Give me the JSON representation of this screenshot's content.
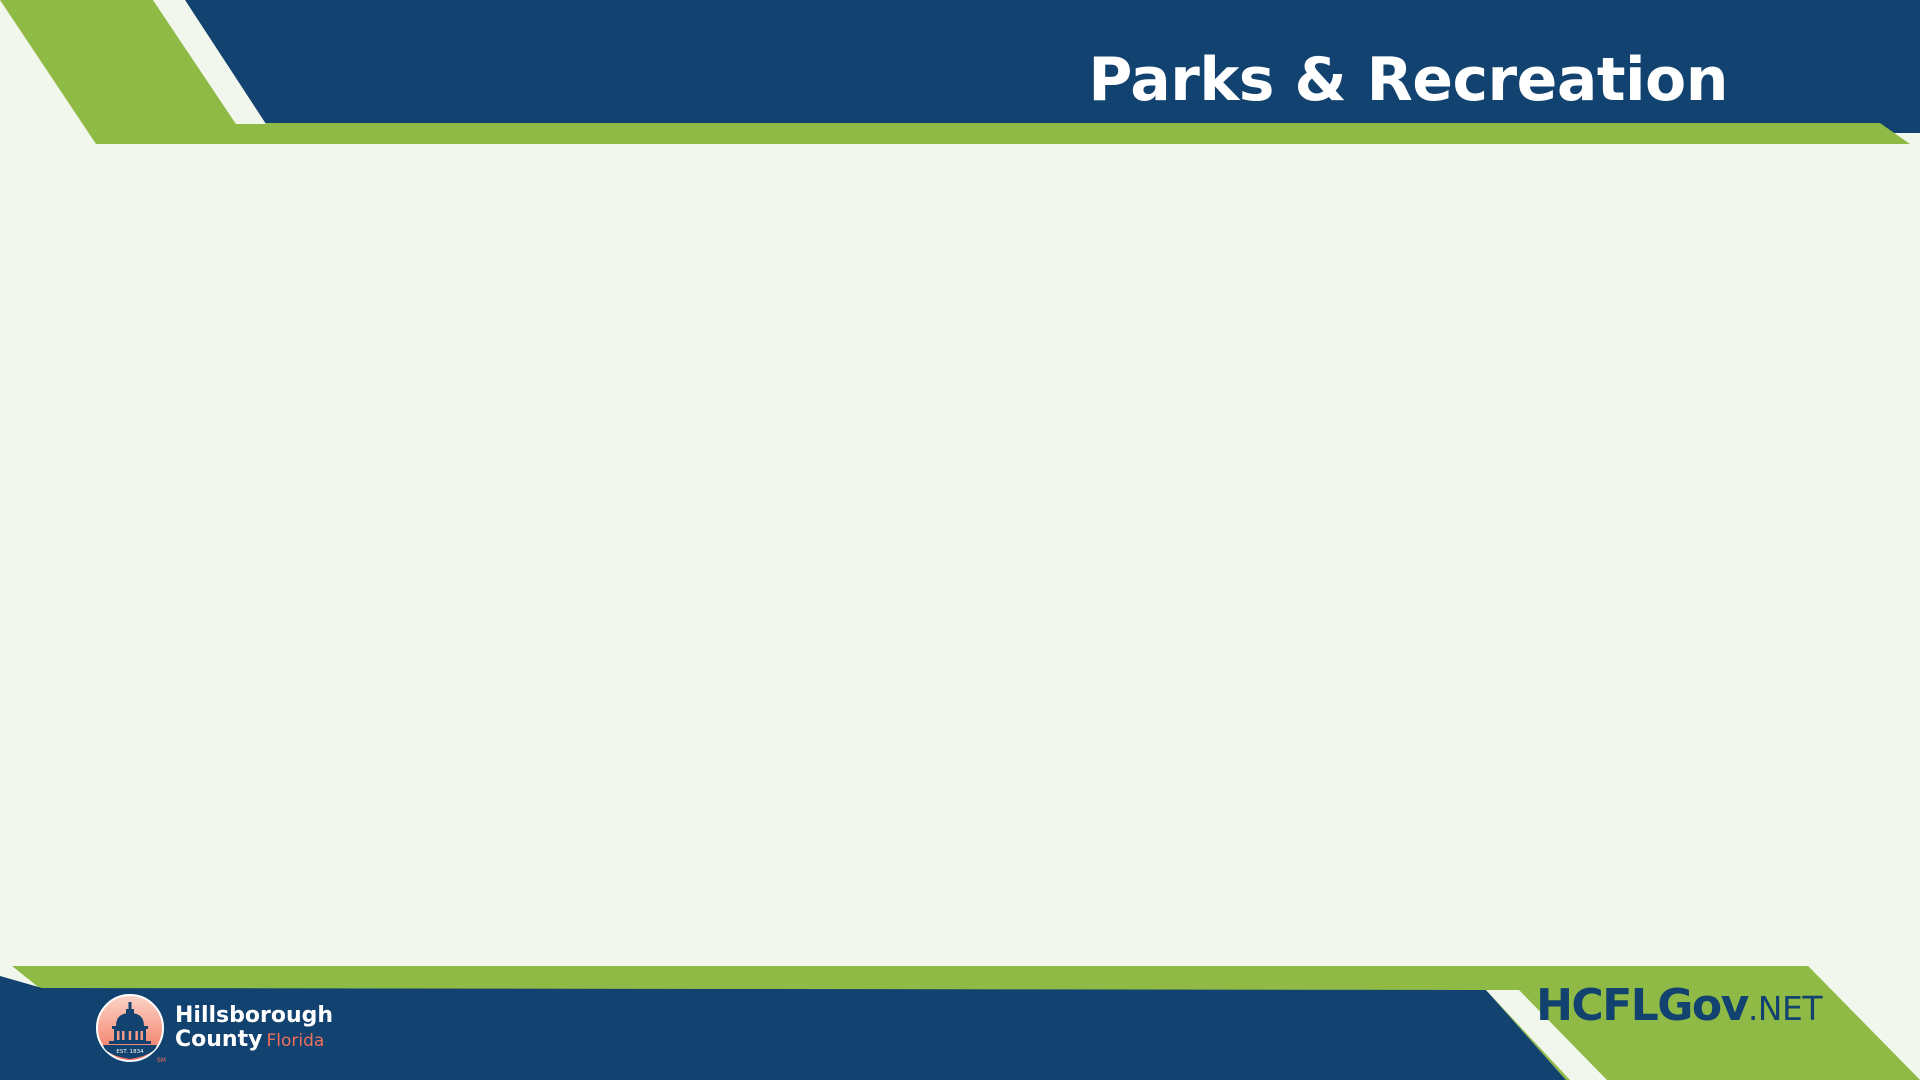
{
  "header": {
    "title": "Parks & Recreation"
  },
  "footer": {
    "logo": {
      "name_line1": "Hillsborough",
      "name_line2": "County",
      "state": "Florida",
      "seal_text": "EST. 1834",
      "trademark": "SM"
    },
    "website": {
      "main": "HCFLGov",
      "tld": ".NET"
    }
  },
  "colors": {
    "navy": "#12426f",
    "green": "#8fba45",
    "background": "#f2f7ed",
    "coral": "#f26f5c"
  }
}
